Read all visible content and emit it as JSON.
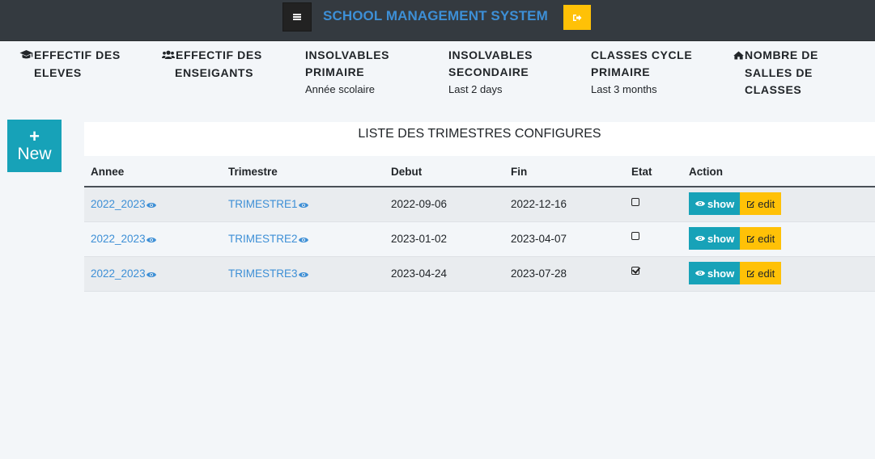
{
  "header": {
    "title": "SCHOOL MANAGEMENT SYSTEM",
    "menu_icon": "hamburger-icon",
    "logout_icon": "sign-out-icon",
    "accent_color": "#3d8fd6"
  },
  "stats": [
    {
      "line1": "EFFECTIF DES",
      "line2": "ELEVES",
      "sub": "",
      "icon": "graduation-cap-icon"
    },
    {
      "line1": "EFFECTIF DES",
      "line2": "ENSEIGANTS",
      "sub": "",
      "icon": "users-icon"
    },
    {
      "line1": "INSOLVABLES",
      "line2": "PRIMAIRE",
      "sub": "Année scolaire",
      "icon": ""
    },
    {
      "line1": "INSOLVABLES",
      "line2": "SECONDAIRE",
      "sub": "Last 2 days",
      "icon": ""
    },
    {
      "line1": "CLASSES CYCLE",
      "line2": "PRIMAIRE",
      "sub": "Last 3 months",
      "icon": ""
    },
    {
      "line1": "NOMBRE DE",
      "line2": "SALLES DE",
      "line3": "CLASSES",
      "sub": "",
      "icon": "home-icon"
    }
  ],
  "new_button": {
    "plus": "+",
    "label": "New"
  },
  "table": {
    "title": "LISTE DES TRIMESTRES CONFIGURES",
    "columns": [
      "Annee",
      "Trimestre",
      "Debut",
      "Fin",
      "Etat",
      "Action"
    ],
    "rows": [
      {
        "annee": "2022_2023",
        "trimestre": "TRIMESTRE1",
        "debut": "2022-09-06",
        "fin": "2022-12-16",
        "etat": false
      },
      {
        "annee": "2022_2023",
        "trimestre": "TRIMESTRE2",
        "debut": "2023-01-02",
        "fin": "2023-04-07",
        "etat": false
      },
      {
        "annee": "2022_2023",
        "trimestre": "TRIMESTRE3",
        "debut": "2023-04-24",
        "fin": "2023-07-28",
        "etat": true
      }
    ],
    "show_label": "show",
    "edit_label": "edit",
    "show_color": "#17a2b8",
    "edit_color": "#ffc107"
  }
}
